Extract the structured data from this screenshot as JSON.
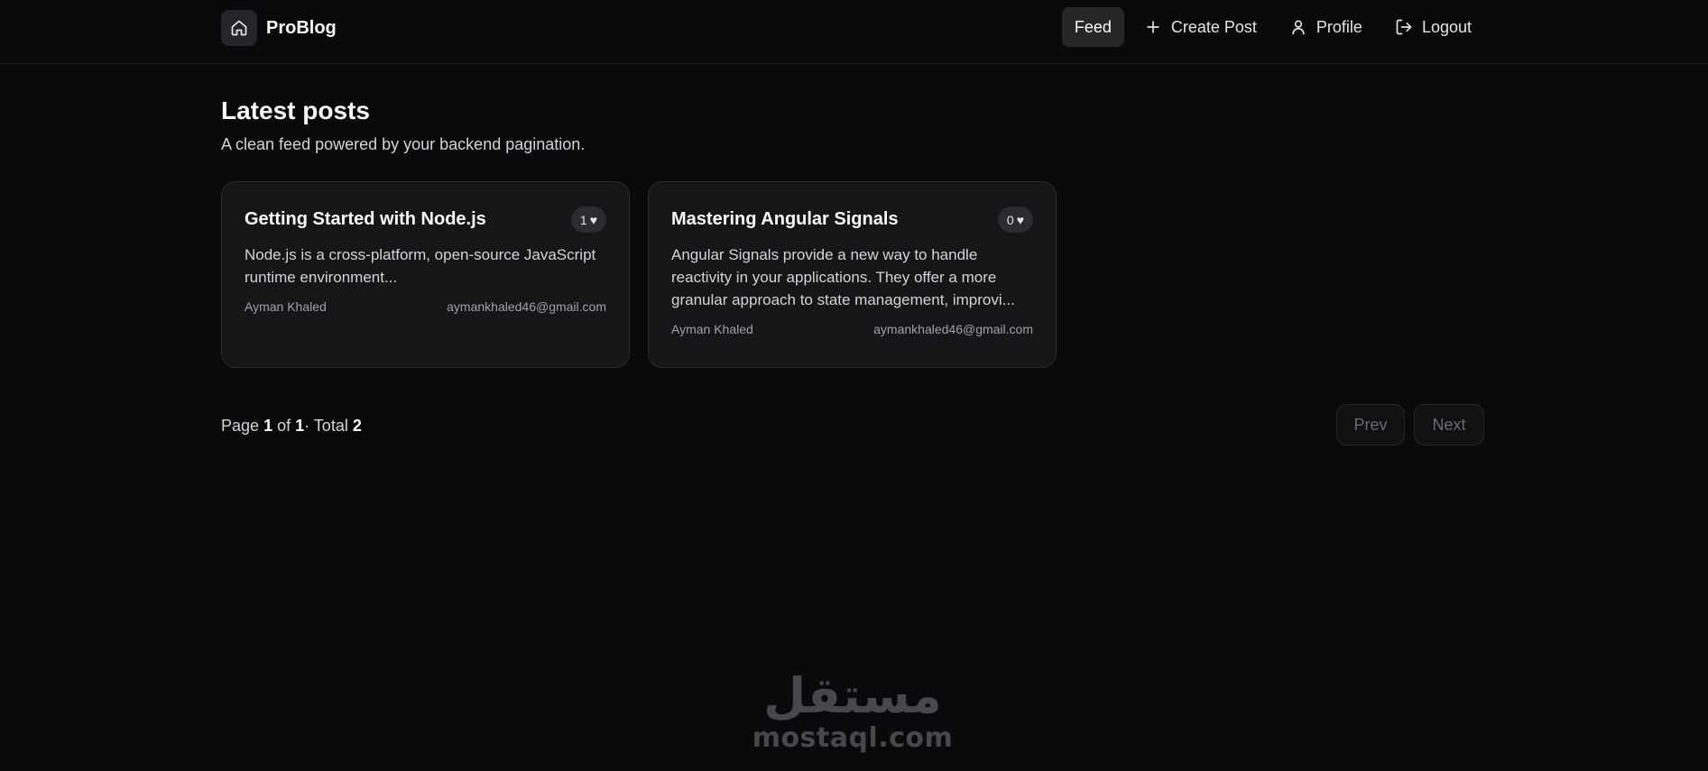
{
  "header": {
    "brand": "ProBlog",
    "nav": [
      {
        "label": "Feed",
        "icon": "none",
        "active": true
      },
      {
        "label": "Create Post",
        "icon": "plus-icon"
      },
      {
        "label": "Profile",
        "icon": "user-icon"
      },
      {
        "label": "Logout",
        "icon": "logout-icon"
      }
    ]
  },
  "main": {
    "title": "Latest posts",
    "subtitle": "A clean feed powered by your backend pagination.",
    "posts": [
      {
        "title": "Getting Started with Node.js",
        "likes": "1",
        "excerpt": "Node.js is a cross-platform, open-source JavaScript runtime environment...",
        "author": "Ayman Khaled",
        "email": "aymankhaled46@gmail.com"
      },
      {
        "title": "Mastering Angular Signals",
        "likes": "0",
        "excerpt": "Angular Signals provide a new way to handle reactivity in your applications. They offer a more granular approach to state management, improvi...",
        "author": "Ayman Khaled",
        "email": "aymankhaled46@gmail.com"
      }
    ],
    "pagination": {
      "page_label": "Page",
      "page": "1",
      "of_label": "of",
      "pages": "1",
      "total_label": "· Total",
      "total": "2",
      "prev": "Prev",
      "next": "Next"
    }
  },
  "watermark": {
    "arabic": "مستقل",
    "latin": "mostaql.com"
  },
  "colors": {
    "background": "#0a0a0c",
    "card": "#161618",
    "active_nav": "#27272a",
    "muted_text": "#a1a1aa"
  }
}
